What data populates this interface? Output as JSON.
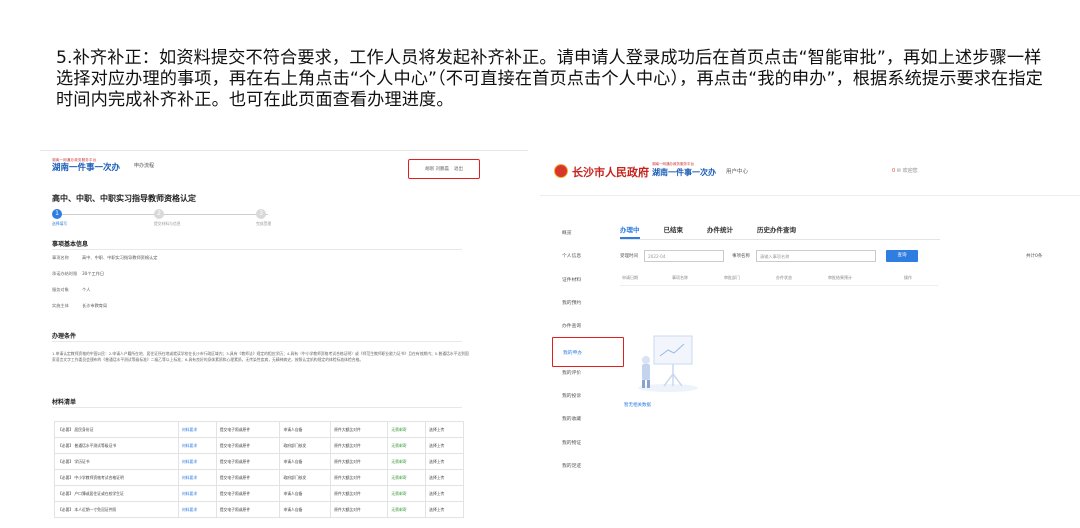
{
  "instruction": "5.补齐补正：如资料提交不符合要求，工作人员将发起补齐补正。请申请人登录成功后在首页点击“智能审批”，再如上述步骤一样选择对应办理的事项，再在右上角点击“个人中心”（不可直接在首页点击个人中心），再点击“我的申办”，根据系统提示要求在指定时间内完成补齐补正。也可在此页面查看办理进度。",
  "left": {
    "logo_small": "湖南一网通办政务服务平台",
    "logo_big": "湖南一件事一次办",
    "nav": "申办流程",
    "user_name": "胡刚 刘鹏磊",
    "user_logout": "退出",
    "title": "高中、中职、中职实习指导教师资格认定",
    "steps": [
      "选择填写",
      "提交材料与信息",
      "完成受理"
    ],
    "basic_title": "事项基本信息",
    "info": [
      {
        "k": "事项名称",
        "v": "高中、中职、中职实习指导教师资格认定"
      },
      {
        "k": "承诺办结时限",
        "v": "30个工作日"
      },
      {
        "k": "服务对象",
        "v": "个人"
      },
      {
        "k": "实施主体",
        "v": "长沙市教育局"
      }
    ],
    "conditions_title": "办理条件",
    "conditions_text": "1.申请认定教师资格的中国公民：2.申请人户籍所在地、居住证所在地或就读学校在长沙市行政区域内；3.具有《教师法》规定的相应学历；4.具有（中小学教师资格考试合格证明）或《师范生教师职业能力证书》且在有效期内；5.普通话水平达到国家语言文字工作委员会颁布的《普通话水平测试等级标准》二级乙等以上标准；6.具有良好的身体素质和心理素质，无传染性疾病，无精神病史，按照认定机构规定的体检标准体检合格。",
    "materials_title": "材料清单",
    "materials": [
      {
        "name": "【必要】 居民身份证",
        "req": "材料要求",
        "sub": "提交电子照或原件",
        "from": "申请人自备",
        "status": "原件大额比对件",
        "act": "无需邮寄",
        "cta": "选择上传"
      },
      {
        "name": "【必要】 普通话水平测试等级证书",
        "req": "材料要求",
        "sub": "提交电子照或原件",
        "from": "政府部门核发",
        "status": "原件大额比对件",
        "act": "无需邮寄",
        "cta": "选择上传"
      },
      {
        "name": "【必要】 学历证书",
        "req": "材料要求",
        "sub": "提交电子照或原件",
        "from": "申请人自备",
        "status": "原件大额比对件",
        "act": "无需邮寄",
        "cta": "选择上传"
      },
      {
        "name": "【必要】 中小学教师资格考试合格证明",
        "req": "材料要求",
        "sub": "提交电子照或原件",
        "from": "政府部门核发",
        "status": "原件大额比对件",
        "act": "无需邮寄",
        "cta": "选择上传"
      },
      {
        "name": "【必要】 户口簿或居住证或在校学生证",
        "req": "材料要求",
        "sub": "提交电子照或原件",
        "from": "申请人自备",
        "status": "原件大额比对件",
        "act": "无需邮寄",
        "cta": "选择上传"
      },
      {
        "name": "【必要】 本人近期一寸免冠证件照",
        "req": "材料要求",
        "sub": "提交电子照或原件",
        "from": "申请人自备",
        "status": "原件大额比对件",
        "act": "无需邮寄",
        "cta": "选择上传"
      }
    ]
  },
  "right": {
    "gov_name": "长沙市人民政府",
    "hn_small": "湖南一网通办政务服务平台",
    "hn_big": "湖南一件事一次办",
    "center": "用户中心",
    "user_badge": "0",
    "user_name": "欢迎您",
    "side": [
      "概览",
      "个人信息",
      "证件材料",
      "我的预约",
      "办件查询",
      "我的申办",
      "我的评价",
      "我的投诉",
      "我的收藏",
      "我的物证",
      "我的足迹"
    ],
    "tabs": [
      "办理中",
      "已结束",
      "办件统计",
      "历史办件查询"
    ],
    "filter": {
      "date_label": "受理时间",
      "date_value": "2022-04",
      "name_label": "事项名称",
      "name_placeholder": "请输入事项名称",
      "search": "查询",
      "total": "共计0条"
    },
    "columns": [
      "申请日期",
      "事项名称",
      "审批部门",
      "办件状态",
      "审批结果预计",
      "操作"
    ],
    "empty": "暂无相关数据"
  }
}
